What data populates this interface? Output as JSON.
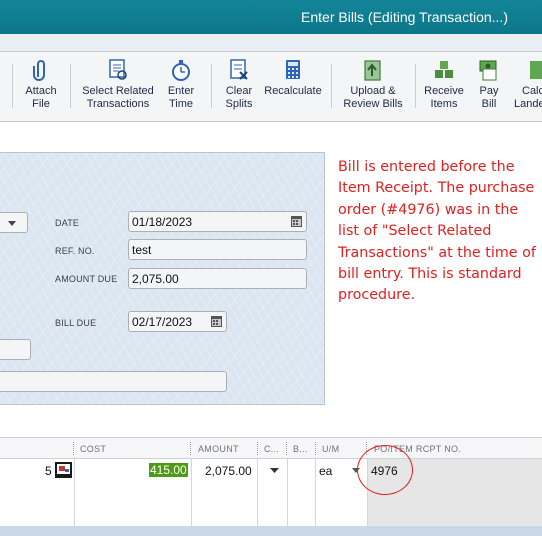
{
  "window": {
    "title": "Enter Bills (Editing Transaction...)"
  },
  "toolbar": {
    "attach_file": [
      "Attach",
      "File"
    ],
    "select_related": [
      "Select Related",
      "Transactions"
    ],
    "enter_time": [
      "Enter",
      "Time"
    ],
    "clear_splits": [
      "Clear",
      "Splits"
    ],
    "recalculate": "Recalculate",
    "upload_review": [
      "Upload &",
      "Review Bills"
    ],
    "receive_items": [
      "Receive",
      "Items"
    ],
    "pay_bill": [
      "Pay",
      "Bill"
    ],
    "calc_landed": [
      "Calc",
      "Lande"
    ]
  },
  "form": {
    "date_label": "DATE",
    "date_value": "01/18/2023",
    "ref_label": "REF. NO.",
    "ref_value": "test",
    "amount_label": "AMOUNT DUE",
    "amount_value": "2,075.00",
    "bill_due_label": "BILL DUE",
    "bill_due_value": "02/17/2023"
  },
  "annotation": "Bill is entered before the Item Receipt. The purchase order (#4976) was in the list of \"Select Related Transactions\" at the time of bill entry. This is standard procedure.",
  "grid": {
    "headers": {
      "cost": "COST",
      "amount": "AMOUNT",
      "c": "C...",
      "b": "B...",
      "um": "U/M",
      "po": "PO/ITEM RCPT NO."
    },
    "row": {
      "qty": "5",
      "cost": "415.00",
      "amount": "2,075.00",
      "um": "ea",
      "po": "4976"
    }
  },
  "colors": {
    "titlebar": "#138599",
    "check_bg": "#dbe6f1",
    "annotation": "#e02020",
    "cost_highlight": "#4f9a14"
  },
  "icons": [
    "paperclip-icon",
    "select-related-icon",
    "stopwatch-icon",
    "clear-splits-icon",
    "calculator-icon",
    "upload-review-icon",
    "receive-items-icon",
    "pay-bill-icon",
    "calendar-icon",
    "dropdown-arrow-icon",
    "item-detail-icon"
  ]
}
